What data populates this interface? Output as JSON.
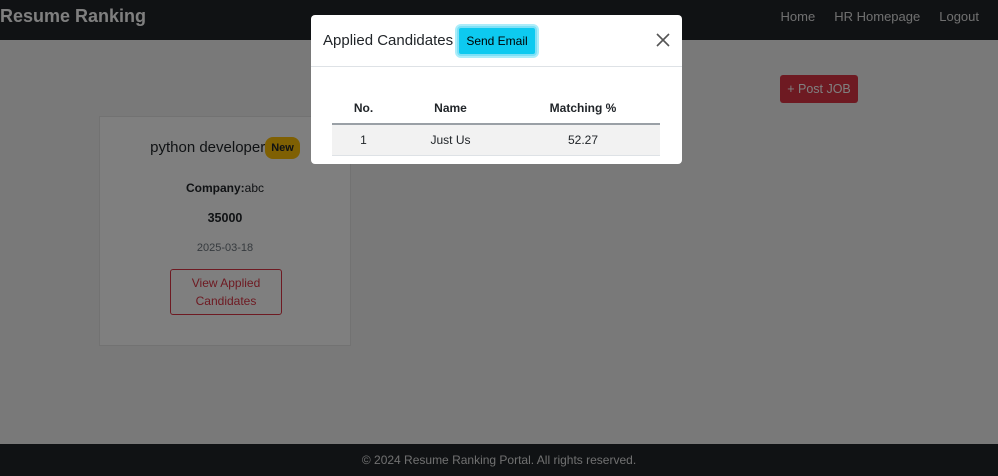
{
  "navbar": {
    "brand": "Resume Ranking",
    "links": [
      "Home",
      "HR Homepage",
      "Logout"
    ]
  },
  "main": {
    "post_job_label": "+ Post JOB",
    "job": {
      "title": "python developer",
      "badge": "New",
      "company_label": "Company:",
      "company": "abc",
      "salary": "35000",
      "date": "2025-03-18",
      "view_button": "View Applied Candidates"
    }
  },
  "modal": {
    "title": "Applied Candidates",
    "send_email_label": "Send Email",
    "columns": [
      "No.",
      "Name",
      "Matching %"
    ],
    "rows": [
      [
        "1",
        "Just Us",
        "52.27"
      ]
    ]
  },
  "footer": {
    "text": "© 2024 Resume Ranking Portal. All rights reserved."
  },
  "colors": {
    "navbar_bg": "#212529",
    "danger": "#dc3545",
    "info": "#0dcaf0",
    "badge": "#ffc107"
  }
}
